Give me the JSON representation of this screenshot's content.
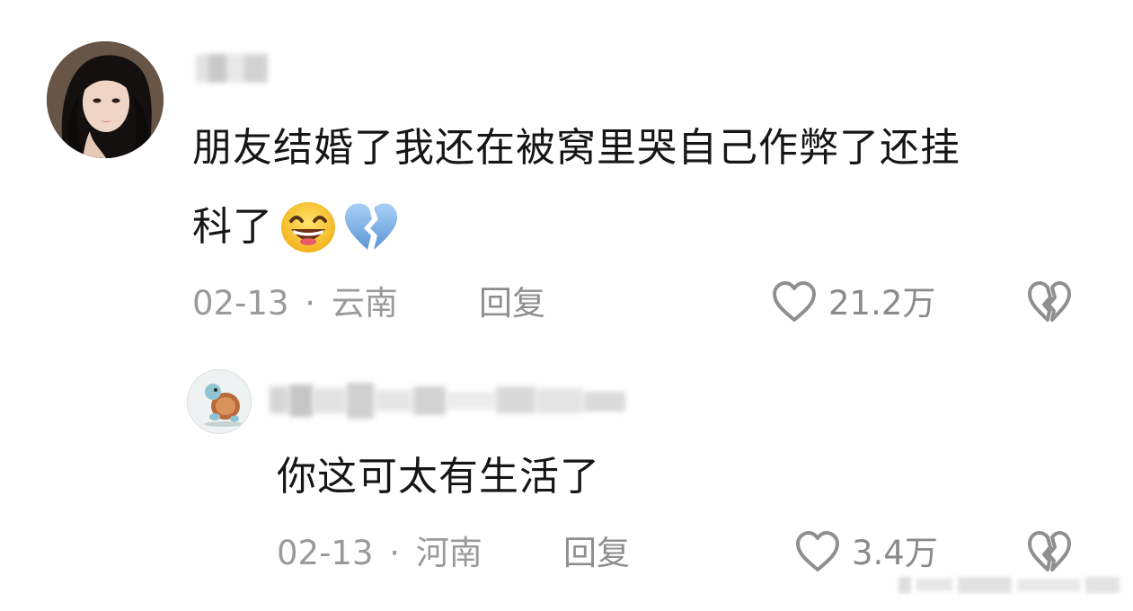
{
  "comments": [
    {
      "text_line1": "朋友结婚了我还在被窝里哭自己作弊了还挂",
      "text_line2": "科了",
      "emojis": [
        "grinning-squinting-face-icon",
        "broken-heart-icon"
      ],
      "date": "02-13",
      "separator": "·",
      "location": "云南",
      "reply_label": "回复",
      "likes": "21.2万"
    },
    {
      "text": "你这可太有生活了",
      "date": "02-13",
      "separator": "·",
      "location": "河南",
      "reply_label": "回复",
      "likes": "3.4万"
    }
  ],
  "colors": {
    "text": "#161616",
    "meta": "#9a9a9a",
    "broken_heart_emoji": "#8ab6e8",
    "emoji_face": "#f7c234"
  }
}
